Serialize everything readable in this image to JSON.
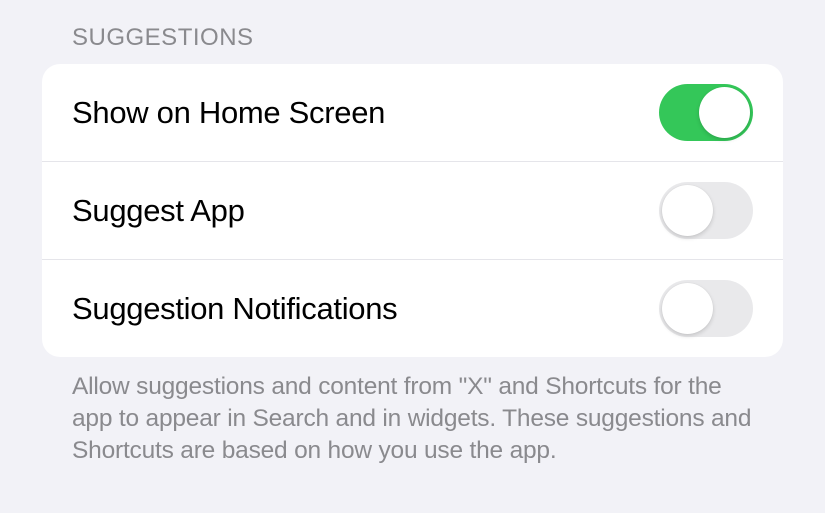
{
  "section": {
    "header": "SUGGESTIONS",
    "rows": [
      {
        "label": "Show on Home Screen",
        "enabled": true
      },
      {
        "label": "Suggest App",
        "enabled": false
      },
      {
        "label": "Suggestion Notifications",
        "enabled": false
      }
    ],
    "footer": "Allow suggestions and content from \"X\" and Shortcuts for the app to appear in Search and in widgets. These suggestions and Shortcuts are based on how you use the app."
  }
}
